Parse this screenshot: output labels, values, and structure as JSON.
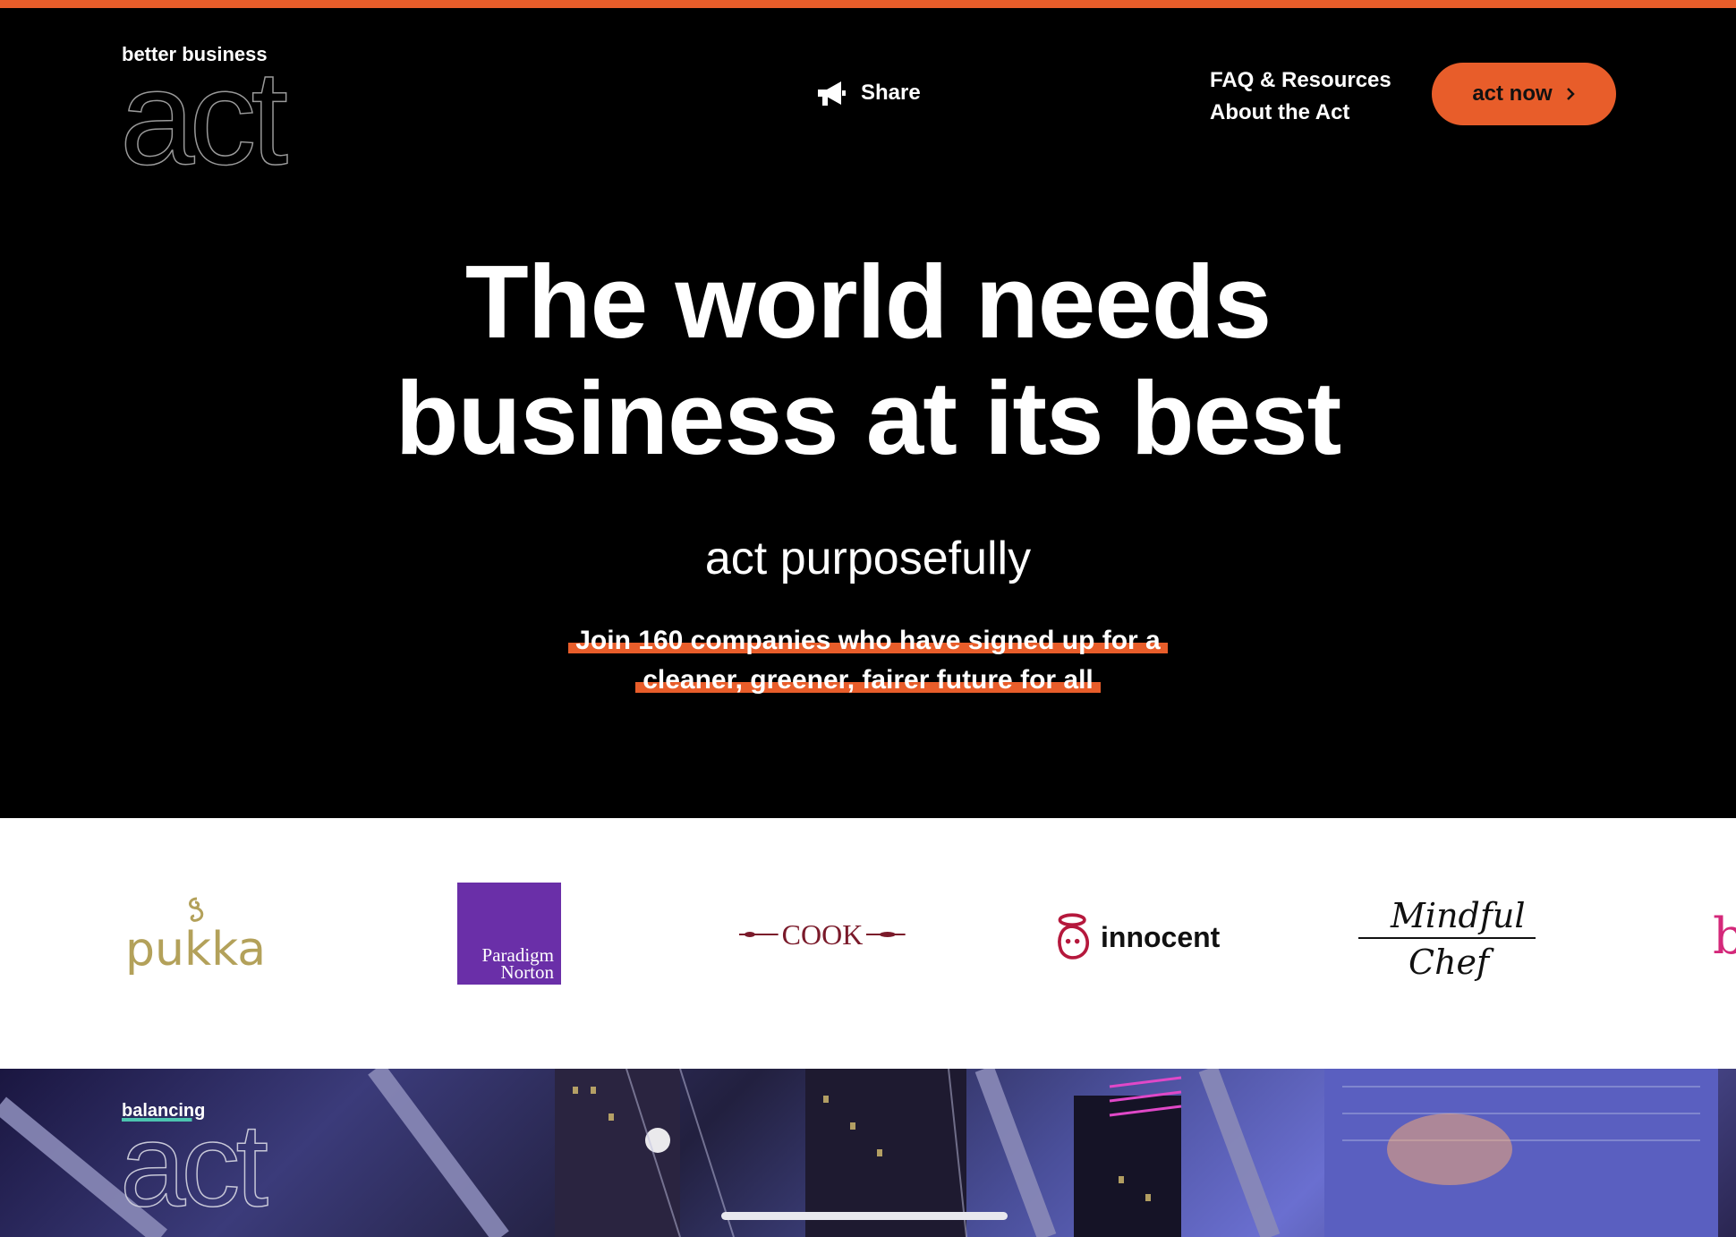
{
  "header": {
    "logo_small": "better business",
    "logo_big": "act",
    "share_label": "Share",
    "nav": [
      {
        "label": "FAQ & Resources"
      },
      {
        "label": "About the Act"
      }
    ],
    "cta_label": "act now"
  },
  "hero": {
    "title_line1": "The world needs",
    "title_line2": "business at its best",
    "subtitle": "act purposefully",
    "join_line1": "Join 160 companies who have signed up for a",
    "join_line2": "cleaner, greener, fairer future for all"
  },
  "brands": {
    "pukka": "pukka",
    "paradigm_line1": "Paradigm",
    "paradigm_line2": "Norton",
    "cook": "COOK",
    "innocent": "innocent",
    "mindful_line1": "Mindful",
    "mindful_line2": "Chef",
    "partial": "b"
  },
  "section2": {
    "logo_small": "balancing",
    "logo_big": "act"
  },
  "colors": {
    "accent": "#e85d2a",
    "background": "#000000",
    "paradigm_purple": "#6a2fa8",
    "pukka_gold": "#b3a15a",
    "cook_red": "#7a1a2a",
    "innocent_red": "#b5183c"
  }
}
